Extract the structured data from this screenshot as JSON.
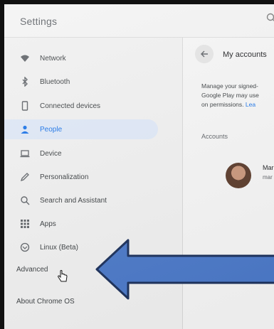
{
  "app": {
    "title": "Settings"
  },
  "sidebar": {
    "items": [
      {
        "label": "Network",
        "icon": "wifi-icon"
      },
      {
        "label": "Bluetooth",
        "icon": "bluetooth-icon"
      },
      {
        "label": "Connected devices",
        "icon": "phone-icon"
      },
      {
        "label": "People",
        "icon": "person-icon",
        "selected": true
      },
      {
        "label": "Device",
        "icon": "laptop-icon"
      },
      {
        "label": "Personalization",
        "icon": "pencil-icon"
      },
      {
        "label": "Search and Assistant",
        "icon": "search-icon"
      },
      {
        "label": "Apps",
        "icon": "grid-icon"
      },
      {
        "label": "Linux (Beta)",
        "icon": "linux-icon"
      }
    ],
    "advanced_label": "Advanced",
    "about_label": "About Chrome OS"
  },
  "main": {
    "title": "My accounts",
    "desc_line1": "Manage your signed-",
    "desc_line2": "Google Play may use",
    "desc_line3": "on permissions. ",
    "desc_link": "Lea",
    "section": "Accounts",
    "account_name": "Mar",
    "account_email": "mar"
  },
  "colors": {
    "accent": "#1a73e8",
    "selected_bg": "#dfe8f7",
    "arrow_fill": "#4a78c8",
    "arrow_stroke": "#1a2f5a"
  }
}
